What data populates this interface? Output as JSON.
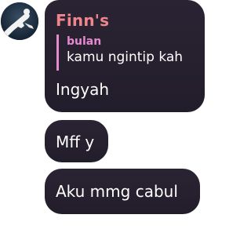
{
  "avatar": {
    "icon": "avatar-icon"
  },
  "messages": [
    {
      "sender": "Finn's",
      "reply": {
        "author": "bulan",
        "text": "kamu ngintip kah"
      },
      "text": "Ingyah"
    },
    {
      "text": "Mff y"
    },
    {
      "text": "Aku mmg cabul"
    }
  ],
  "colors": {
    "bubble": "#241f2c",
    "sender": "#f0868c",
    "reply_accent": "#e58ad0",
    "text": "#ffffff"
  }
}
